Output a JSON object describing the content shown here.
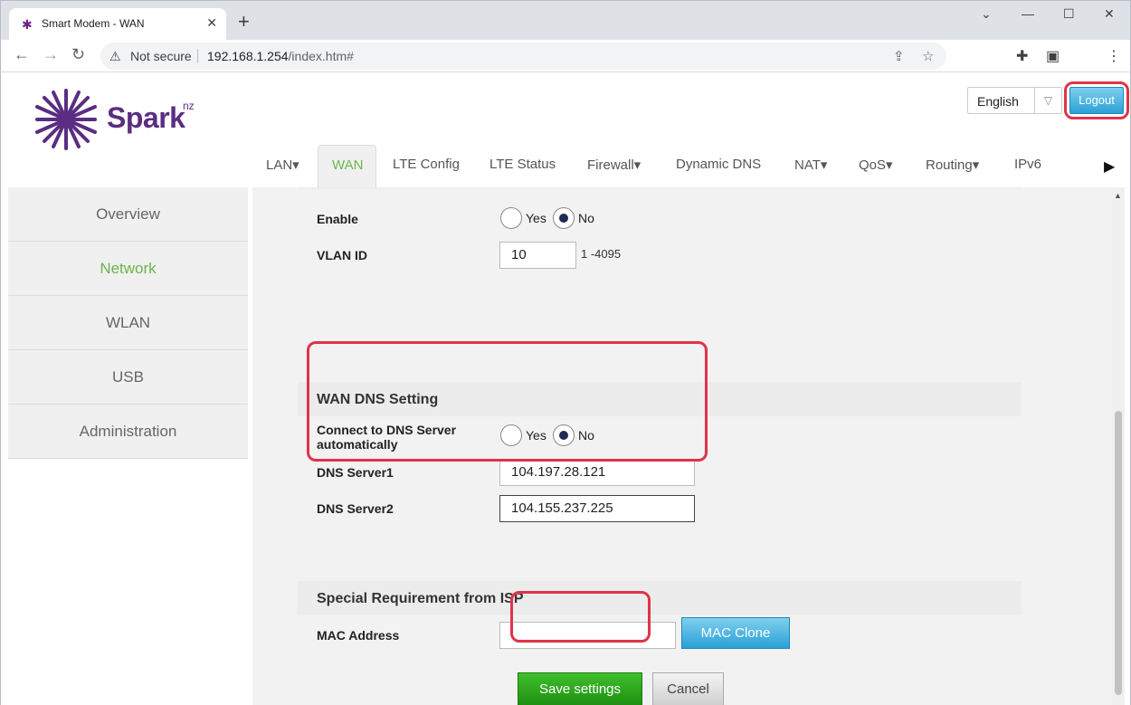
{
  "browser": {
    "tab_title": "Smart Modem - WAN",
    "new_tab": "+",
    "not_secure": "Not secure",
    "url_host": "192.168.1.254",
    "url_path": "/index.htm#"
  },
  "header": {
    "brand": "Spark",
    "brand_suffix": "nz",
    "language": "English",
    "logout": "Logout"
  },
  "nav": {
    "items": [
      "LAN▾",
      "WAN",
      "LTE Config",
      "LTE Status",
      "Firewall▾",
      "Dynamic DNS",
      "NAT▾",
      "QoS▾",
      "Routing▾",
      "IPv6"
    ],
    "active": "WAN"
  },
  "sidebar": {
    "items": [
      "Overview",
      "Network",
      "WLAN",
      "USB",
      "Administration"
    ],
    "active": "Network"
  },
  "form": {
    "vlan": {
      "enable_label": "Enable",
      "yes": "Yes",
      "no": "No",
      "selected": "No",
      "vlan_id_label": "VLAN ID",
      "vlan_id_value": "10",
      "vlan_id_hint": "1 -4095"
    },
    "dns": {
      "title": "WAN DNS Setting",
      "auto_label_line1": "Connect to DNS Server",
      "auto_label_line2": "automatically",
      "yes": "Yes",
      "no": "No",
      "selected": "No",
      "server1_label": "DNS Server1",
      "server1_value": "104.197.28.121",
      "server2_label": "DNS Server2",
      "server2_value": "104.155.237.225"
    },
    "isp": {
      "title": "Special Requirement from ISP",
      "mac_label": "MAC Address",
      "mac_value": "",
      "mac_clone": "MAC Clone"
    },
    "save": "Save settings",
    "cancel": "Cancel"
  },
  "colors": {
    "brand_purple": "#5a2d82",
    "active_green": "#6bb54a",
    "highlight_red": "#e0334a",
    "button_blue": "#2aa0d6",
    "save_green": "#1f8f12"
  }
}
